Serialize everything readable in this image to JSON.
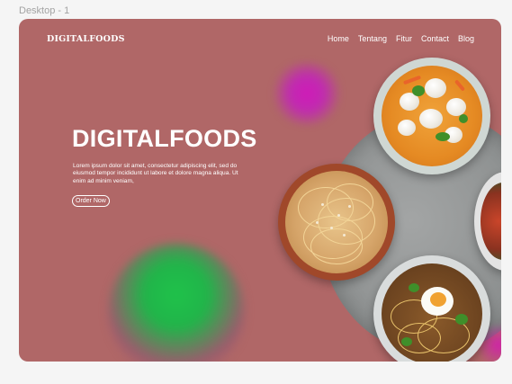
{
  "canvas": {
    "frame_label": "Desktop - 1"
  },
  "header": {
    "logo": "DIGITALFOODS",
    "nav": [
      "Home",
      "Tentang",
      "Fitur",
      "Contact",
      "Blog"
    ]
  },
  "hero": {
    "title": "DIGITALFOODS",
    "description": "Lorem ipsum dolor sit amet, consectetur adipiscing elit, sed do eiusmod tempor incididunt ut labore et dolore magna aliqua. Ut enim ad minim veniam,",
    "cta": "Order Now"
  },
  "colors": {
    "background": "#b06767",
    "accent_magenta": "#c02bb0",
    "accent_green": "#21b44a",
    "text": "#ffffff"
  }
}
